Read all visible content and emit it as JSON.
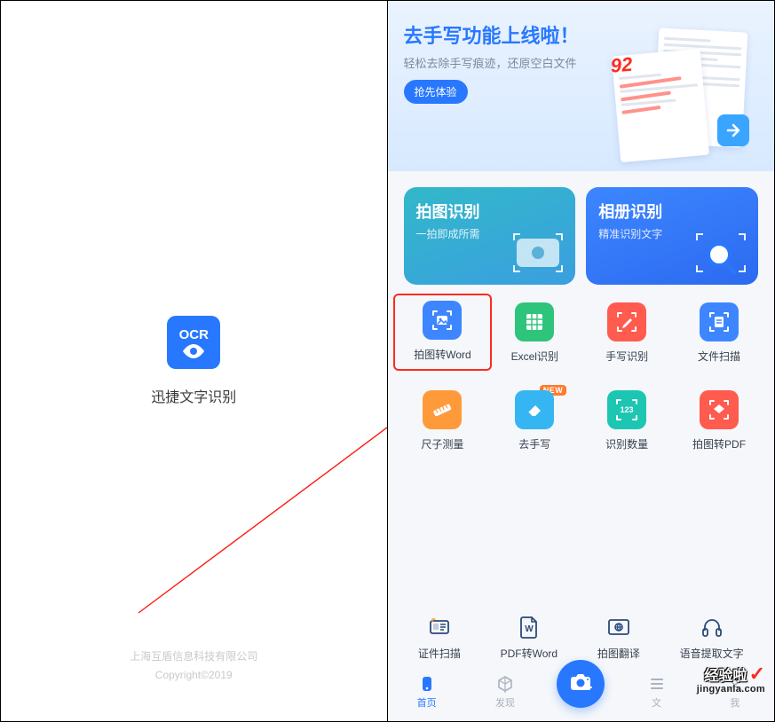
{
  "splash": {
    "logo_top": "OCR",
    "title": "迅捷文字识别",
    "footer_company": "上海互盾信息科技有限公司",
    "footer_copyright": "Copyright©2019"
  },
  "banner": {
    "title": "去手写功能上线啦！",
    "subtitle": "轻松去除手写痕迹，还原空白文件",
    "button": "抢先体验",
    "score": "92"
  },
  "cards": {
    "photo": {
      "title": "拍图识别",
      "sub": "一拍即成所需"
    },
    "album": {
      "title": "相册识别",
      "sub": "精准识别文字"
    }
  },
  "tools": [
    {
      "label": "拍图转Word",
      "color": "blue",
      "icon": "image-frame",
      "highlighted": true
    },
    {
      "label": "Excel识别",
      "color": "green",
      "icon": "grid"
    },
    {
      "label": "手写识别",
      "color": "red",
      "icon": "pen-frame"
    },
    {
      "label": "文件扫描",
      "color": "blue",
      "icon": "scan-doc"
    },
    {
      "label": "尺子测量",
      "color": "orange",
      "icon": "ruler"
    },
    {
      "label": "去手写",
      "color": "sky",
      "icon": "eraser",
      "badge": "NEW"
    },
    {
      "label": "识别数量",
      "color": "teal",
      "icon": "number-frame",
      "num": "123"
    },
    {
      "label": "拍图转PDF",
      "color": "red",
      "icon": "pdf-frame"
    }
  ],
  "bottom_tools": [
    {
      "label": "证件扫描",
      "icon": "id-card"
    },
    {
      "label": "PDF转Word",
      "icon": "file-w"
    },
    {
      "label": "拍图翻译",
      "icon": "translate"
    },
    {
      "label": "语音提取文字",
      "icon": "headphones"
    }
  ],
  "nav": {
    "home": "首页",
    "discover": "发现",
    "files_prefix": "文",
    "mine_prefix": "我"
  },
  "watermark": {
    "main": "经验啦",
    "sub": "jingyanla.com"
  }
}
